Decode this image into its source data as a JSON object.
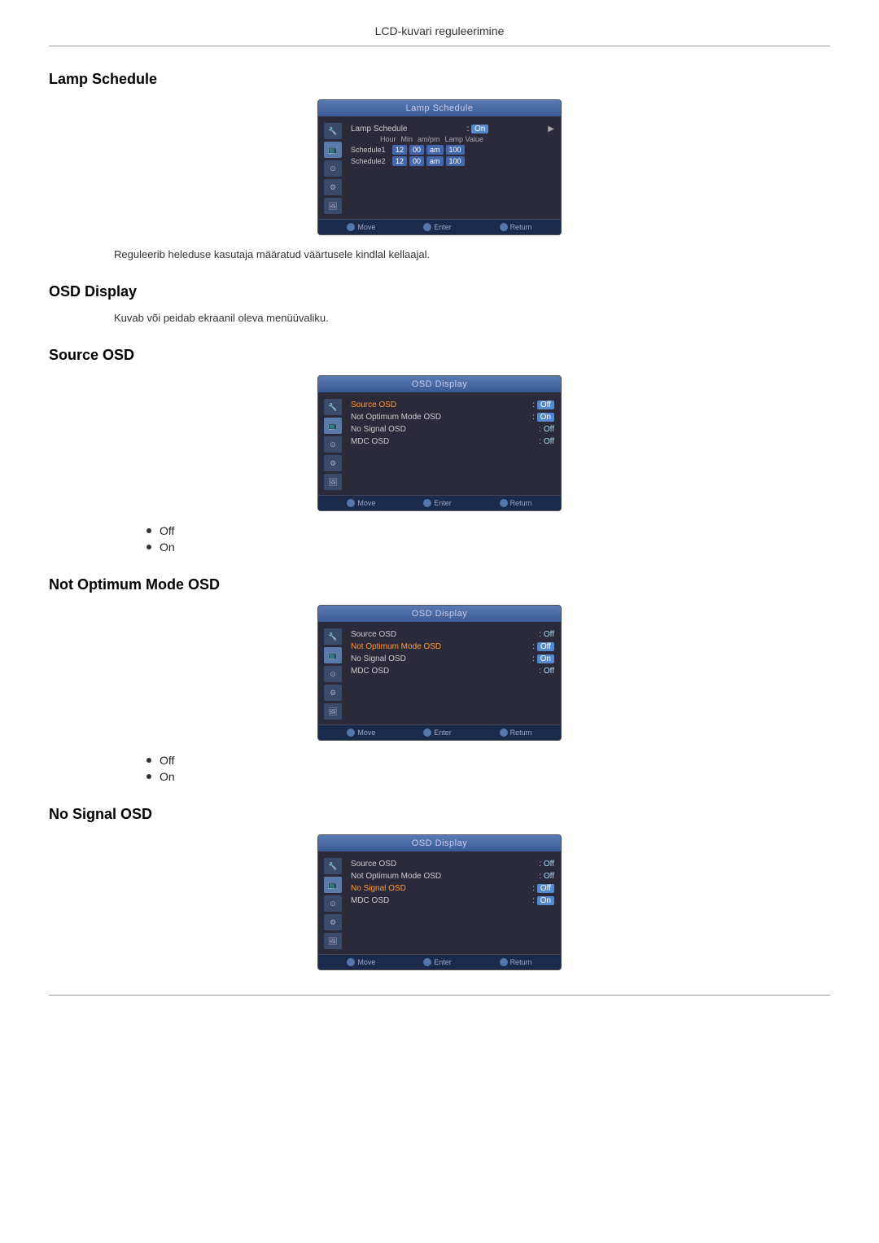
{
  "header": {
    "title": "LCD-kuvari reguleerimine"
  },
  "sections": {
    "lamp_schedule": {
      "title": "Lamp Schedule",
      "description": "Reguleerib heleduse kasutaja määratud väärtusele kindlal kellaajal.",
      "screen_title": "Lamp Schedule",
      "row_label": "Lamp Schedule",
      "row_value": ": On",
      "schedule_headers": [
        "Hour",
        "Min",
        "am/pm",
        "Lamp Value"
      ],
      "schedule1_label": "Schedule1",
      "schedule1_fields": [
        "12",
        "00",
        "am",
        "100"
      ],
      "schedule2_label": "Schedule2",
      "schedule2_fields": [
        "12",
        "00",
        "am",
        "100"
      ],
      "footer": [
        "Move",
        "Enter",
        "Return"
      ]
    },
    "osd_display": {
      "title": "OSD Display",
      "description": "Kuvab või peidab ekraanil oleva menüüvaliku."
    },
    "source_osd": {
      "title": "Source OSD",
      "screen_title": "OSD Display",
      "rows": [
        {
          "label": "Source OSD",
          "value": "Off",
          "highlighted": true
        },
        {
          "label": "Not Optimum Mode OSD",
          "value": "On",
          "highlighted": false
        },
        {
          "label": "No Signal OSD",
          "value": "Off",
          "highlighted": false
        },
        {
          "label": "MDC OSD",
          "value": "Off",
          "highlighted": false
        }
      ],
      "footer": [
        "Move",
        "Enter",
        "Return"
      ],
      "bullets": [
        "Off",
        "On"
      ]
    },
    "not_optimum_mode_osd": {
      "title": "Not Optimum Mode OSD",
      "screen_title": "OSD Display",
      "rows": [
        {
          "label": "Source OSD",
          "value": "Off",
          "highlighted": false
        },
        {
          "label": "Not Optimum Mode OSD",
          "value": "Off",
          "highlighted": true
        },
        {
          "label": "No Signal OSD",
          "value": "On",
          "highlighted": false
        },
        {
          "label": "MDC OSD",
          "value": "Off",
          "highlighted": false
        }
      ],
      "footer": [
        "Move",
        "Enter",
        "Return"
      ],
      "bullets": [
        "Off",
        "On"
      ]
    },
    "no_signal_osd": {
      "title": "No Signal OSD",
      "screen_title": "OSD Display",
      "rows": [
        {
          "label": "Source OSD",
          "value": "Off",
          "highlighted": false
        },
        {
          "label": "Not Optimum Mode OSD",
          "value": "Off",
          "highlighted": false
        },
        {
          "label": "No Signal OSD",
          "value": "Off",
          "highlighted": true
        },
        {
          "label": "MDC OSD",
          "value": "On",
          "highlighted": false
        }
      ],
      "footer": [
        "Move",
        "Enter",
        "Return"
      ]
    }
  },
  "icons": {
    "move_icon": "●",
    "enter_icon": "↵",
    "return_icon": "↩"
  }
}
